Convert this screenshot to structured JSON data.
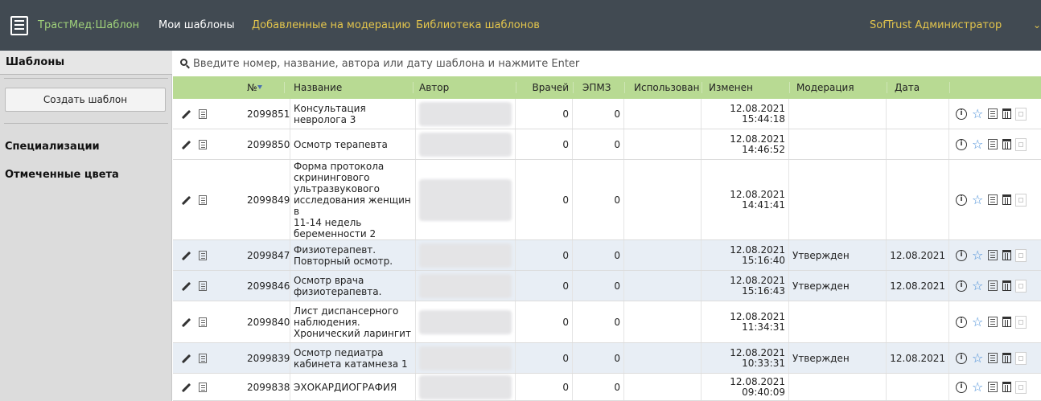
{
  "topbar": {
    "brand": "ТрастМед:Шаблон",
    "nav": [
      {
        "label": "Мои шаблоны",
        "active": true
      },
      {
        "label": "Добавленные на модерацию"
      },
      {
        "label": "Библиотека шаблонов"
      }
    ],
    "user": "SofTrust Администратор",
    "colors": {
      "bg": "#414a52",
      "brand": "#9fd07a",
      "link": "#e3c54c"
    }
  },
  "sidebar": {
    "title": "Шаблоны",
    "create_button": "Создать шаблон",
    "sections": [
      "Специализации",
      "Отмеченные цвета"
    ]
  },
  "search": {
    "placeholder": "Введите номер, название, автора или дату шаблона и нажмите Enter",
    "value": ""
  },
  "table": {
    "header_color": "#b8da93",
    "sort": {
      "column": "№",
      "direction": "desc"
    },
    "columns": [
      "№",
      "Название",
      "Автор",
      "Врачей",
      "ЭПМЗ",
      "Использован",
      "Изменен",
      "Модерация",
      "Дата"
    ],
    "rows": [
      {
        "num": "2099851",
        "name": [
          "Консультация",
          "невролога 3"
        ],
        "doctors": "0",
        "epmz": "0",
        "used": "",
        "changed_date": "12.08.2021",
        "changed_time": "15:44:18",
        "moderation": "",
        "date": "",
        "highlight": false
      },
      {
        "num": "2099850",
        "name": [
          "Осмотр терапевта"
        ],
        "doctors": "0",
        "epmz": "0",
        "used": "",
        "changed_date": "12.08.2021",
        "changed_time": "14:46:52",
        "moderation": "",
        "date": "",
        "highlight": false
      },
      {
        "num": "2099849",
        "name": [
          "Форма протокола",
          "скринингового",
          "ультразвукового",
          "исследования женщин в",
          "11-14 недель",
          "беременности 2"
        ],
        "doctors": "0",
        "epmz": "0",
        "used": "",
        "changed_date": "12.08.2021",
        "changed_time": "14:41:41",
        "moderation": "",
        "date": "",
        "highlight": false
      },
      {
        "num": "2099847",
        "name": [
          "Физиотерапевт.",
          "Повторный осмотр."
        ],
        "doctors": "0",
        "epmz": "0",
        "used": "",
        "changed_date": "12.08.2021",
        "changed_time": "15:16:40",
        "moderation": "Утвержден",
        "date": "12.08.2021",
        "highlight": true
      },
      {
        "num": "2099846",
        "name": [
          "Осмотр врача",
          "физиотерапевта."
        ],
        "doctors": "0",
        "epmz": "0",
        "used": "",
        "changed_date": "12.08.2021",
        "changed_time": "15:16:43",
        "moderation": "Утвержден",
        "date": "12.08.2021",
        "highlight": true
      },
      {
        "num": "2099840",
        "name": [
          "Лист диспансерного",
          "наблюдения.",
          "Хронический ларингит"
        ],
        "doctors": "0",
        "epmz": "0",
        "used": "",
        "changed_date": "12.08.2021",
        "changed_time": "11:34:31",
        "moderation": "",
        "date": "",
        "highlight": false
      },
      {
        "num": "2099839",
        "name": [
          "Осмотр педиатра",
          "кабинета катамнеза 1"
        ],
        "doctors": "0",
        "epmz": "0",
        "used": "",
        "changed_date": "12.08.2021",
        "changed_time": "10:33:31",
        "moderation": "Утвержден",
        "date": "12.08.2021",
        "highlight": true
      },
      {
        "num": "2099838",
        "name": [
          "ЭХОКАРДИОГРАФИЯ"
        ],
        "doctors": "0",
        "epmz": "0",
        "used": "",
        "changed_date": "12.08.2021",
        "changed_time": "09:40:09",
        "moderation": "",
        "date": "",
        "highlight": false
      }
    ],
    "row_actions": [
      "info-icon",
      "star-icon",
      "card-icon",
      "trash-icon",
      "checkbox"
    ]
  }
}
